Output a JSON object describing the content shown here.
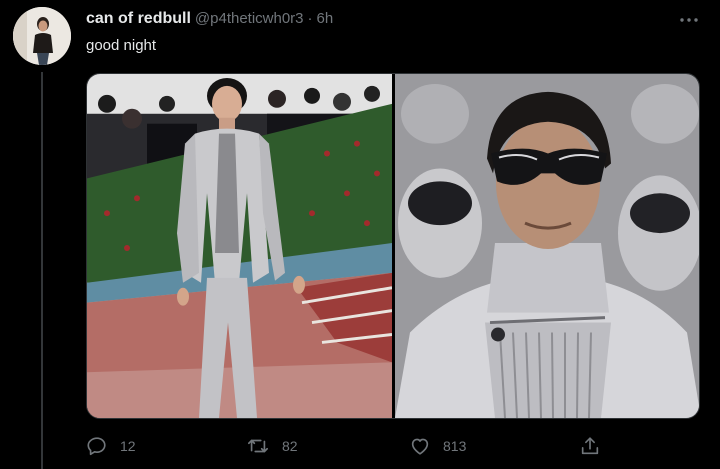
{
  "tweet": {
    "display_name": "can of redbull",
    "handle": "@p4theticwh0r3",
    "separator": "·",
    "time": "6h",
    "text": "good night"
  },
  "stats": {
    "replies": "12",
    "retweets": "82",
    "likes": "813"
  },
  "icons": {
    "more": "more-horizontal-icon",
    "reply": "reply-icon",
    "retweet": "retweet-icon",
    "like": "heart-icon",
    "share": "share-icon"
  },
  "colors": {
    "background": "#000000",
    "primary_text": "#e7e9ea",
    "secondary_text": "#71767b",
    "thread_line": "#333639"
  }
}
